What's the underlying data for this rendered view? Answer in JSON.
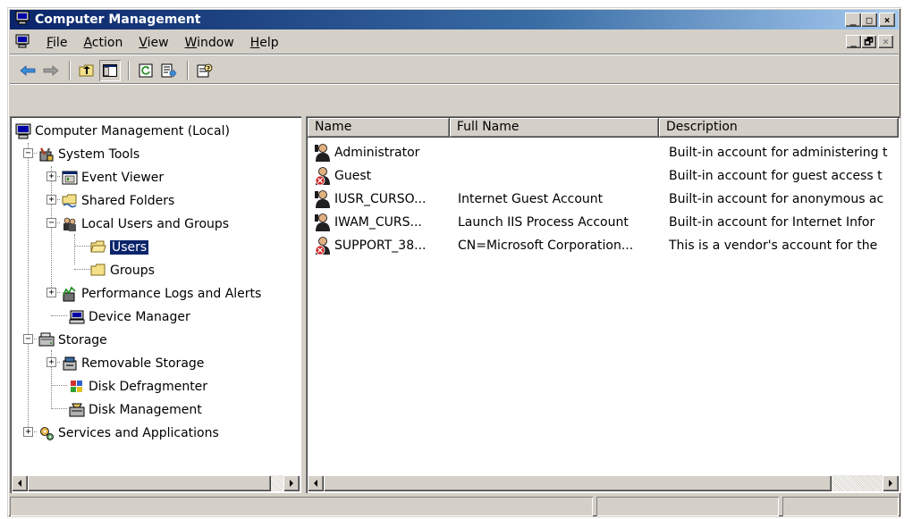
{
  "window": {
    "title": "Computer Management",
    "min_glyph": "_",
    "max_glyph": "□",
    "close_glyph": "×"
  },
  "mdi": {
    "min_glyph": "_",
    "restore_glyph": "🗗",
    "close_glyph": "×"
  },
  "menu": {
    "items": [
      {
        "accel": "F",
        "rest": "ile"
      },
      {
        "accel": "A",
        "rest": "ction"
      },
      {
        "accel": "V",
        "rest": "iew"
      },
      {
        "accel": "W",
        "rest": "indow"
      },
      {
        "accel": "H",
        "rest": "elp"
      }
    ]
  },
  "toolbar": {
    "icons": [
      "back-arrow-icon",
      "forward-arrow-icon",
      "up-one-level-icon",
      "show-hide-tree-icon",
      "refresh-icon",
      "export-list-icon",
      "help-icon"
    ]
  },
  "tree": {
    "root": "Computer Management (Local)",
    "system_tools": "System Tools",
    "event_viewer": "Event Viewer",
    "shared_folders": "Shared Folders",
    "local_users_groups": "Local Users and Groups",
    "users": "Users",
    "groups": "Groups",
    "perf_logs": "Performance Logs and Alerts",
    "device_manager": "Device Manager",
    "storage": "Storage",
    "removable_storage": "Removable Storage",
    "disk_defrag": "Disk Defragmenter",
    "disk_management": "Disk Management",
    "services_apps": "Services and Applications",
    "expanded_glyph": "−",
    "collapsed_glyph": "+"
  },
  "list": {
    "columns": [
      "Name",
      "Full Name",
      "Description"
    ],
    "rows": [
      {
        "name": "Administrator",
        "full_name": "",
        "description": "Built-in account for administering t",
        "disabled": false
      },
      {
        "name": "Guest",
        "full_name": "",
        "description": "Built-in account for guest access t",
        "disabled": true
      },
      {
        "name": "IUSR_CURSO...",
        "full_name": "Internet Guest Account",
        "description": "Built-in account for anonymous ac",
        "disabled": false
      },
      {
        "name": "IWAM_CURS...",
        "full_name": "Launch IIS Process Account",
        "description": "Built-in account for Internet Infor",
        "disabled": false
      },
      {
        "name": "SUPPORT_38...",
        "full_name": "CN=Microsoft Corporation...",
        "description": "This is a vendor's account for the",
        "disabled": true
      }
    ]
  },
  "colors": {
    "title_bar": "#0a246a",
    "face": "#d4d0c8",
    "selection": "#0a246a"
  }
}
